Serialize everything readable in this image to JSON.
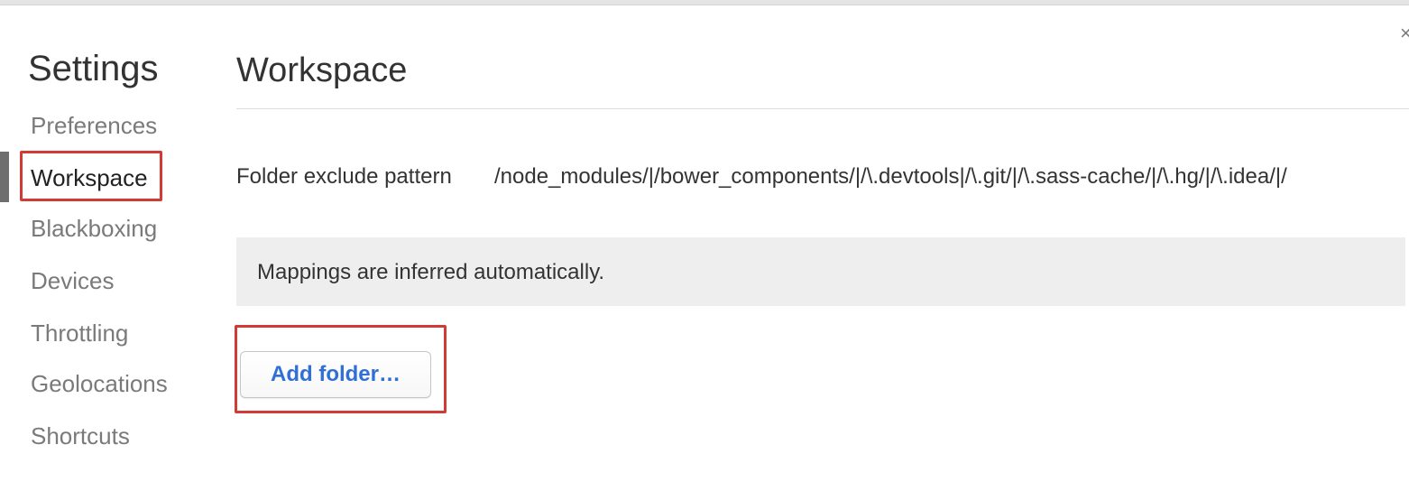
{
  "window": {
    "close_glyph": "×"
  },
  "sidebar": {
    "title": "Settings",
    "items": [
      {
        "label": "Preferences",
        "selected": false
      },
      {
        "label": "Workspace",
        "selected": true
      },
      {
        "label": "Blackboxing",
        "selected": false
      },
      {
        "label": "Devices",
        "selected": false
      },
      {
        "label": "Throttling",
        "selected": false
      },
      {
        "label": "Geolocations",
        "selected": false
      },
      {
        "label": "Shortcuts",
        "selected": false
      }
    ]
  },
  "main": {
    "title": "Workspace",
    "exclude": {
      "label": "Folder exclude pattern",
      "value": "/node_modules/|/bower_components/|/\\.devtools|/\\.git/|/\\.sass-cache/|/\\.hg/|/\\.idea/|/"
    },
    "mappings_notice": "Mappings are inferred automatically.",
    "add_folder_label": "Add folder…"
  },
  "colors": {
    "highlight": "#d23b35",
    "link_blue": "#2f6fd6",
    "notice_bg": "#eeeeee"
  }
}
